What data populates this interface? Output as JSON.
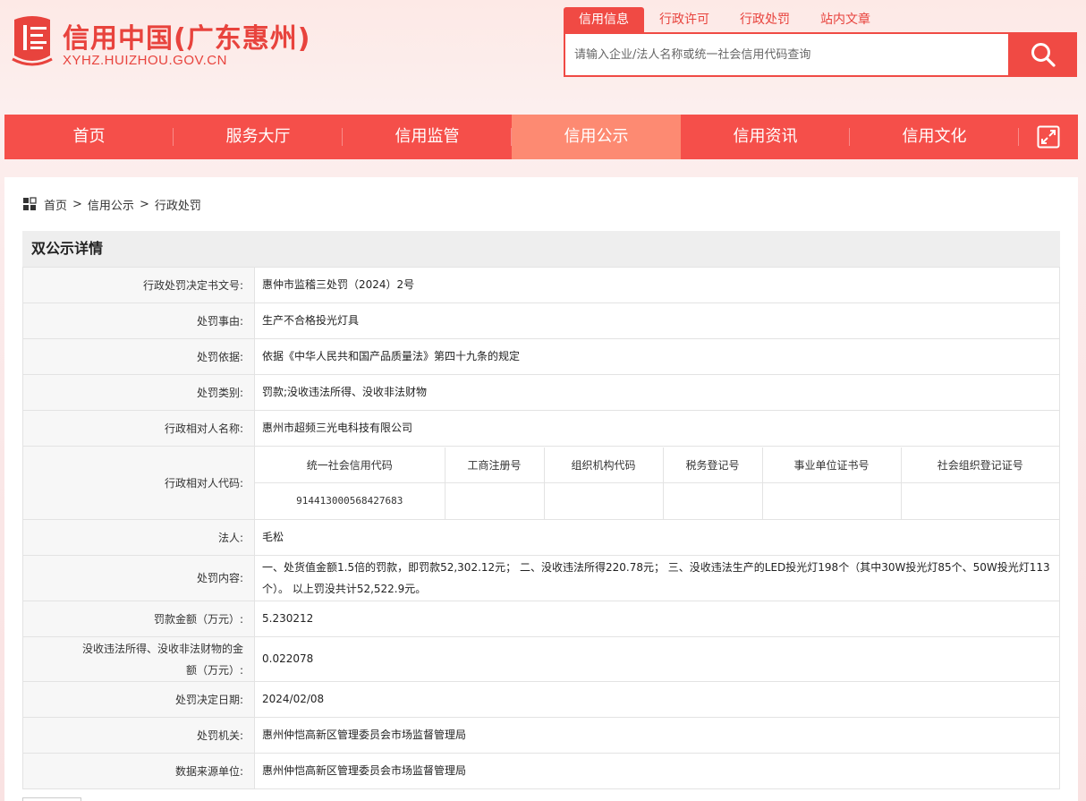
{
  "site": {
    "title": "信用中国(广东惠州)",
    "domain": "XYHZ.HUIZHOU.GOV.CN"
  },
  "colors": {
    "brand": "#f04a44",
    "nav_bg": "#f54f4a",
    "nav_active": "#fd8a72"
  },
  "search": {
    "tabs": [
      "信用信息",
      "行政许可",
      "行政处罚",
      "站内文章"
    ],
    "active_tab": "信用信息",
    "placeholder": "请输入企业/法人名称或统一社会信用代码查询",
    "button_icon": "search-icon"
  },
  "nav": {
    "items": [
      "首页",
      "服务大厅",
      "信用监管",
      "信用公示",
      "信用资讯",
      "信用文化"
    ],
    "active": "信用公示",
    "expand_icon": "expand-icon"
  },
  "breadcrumb": {
    "items": [
      "首页",
      "信用公示",
      "行政处罚"
    ],
    "separator": ">"
  },
  "detail": {
    "heading": "双公示详情",
    "rows": {
      "doc_no": {
        "label": "行政处罚决定书文号:",
        "value": "惠仲市监稽三处罚（2024）2号"
      },
      "reason": {
        "label": "处罚事由:",
        "value": "生产不合格投光灯具"
      },
      "basis": {
        "label": "处罚依据:",
        "value": "依据《中华人民共和国产品质量法》第四十九条的规定"
      },
      "category": {
        "label": "处罚类别:",
        "value": "罚款;没收违法所得、没收非法财物"
      },
      "party_name": {
        "label": "行政相对人名称:",
        "value": "惠州市超频三光电科技有限公司"
      },
      "party_code": {
        "label": "行政相对人代码:",
        "headers": [
          "统一社会信用代码",
          "工商注册号",
          "组织机构代码",
          "税务登记号",
          "事业单位证书号",
          "社会组织登记证号"
        ],
        "values": [
          "91441300056842​7683",
          "",
          "",
          "",
          "",
          ""
        ]
      },
      "legal_person": {
        "label": "法人:",
        "value": "毛松"
      },
      "content": {
        "label": "处罚内容:",
        "value": "一、处货值金额1.5倍的罚款，即罚款52,302.12元； 二、没收违法所得220.78元； 三、没收违法生产的LED投光灯198个（其中30W投光灯85个、50W投光灯113个）。 以上罚没共计52,522.9元。"
      },
      "fine": {
        "label": "罚款金额（万元）:",
        "value": "5.230212"
      },
      "confiscation": {
        "label": "没收违法所得、没收非法财物的金额（万元）:",
        "value": "0.022078"
      },
      "date": {
        "label": "处罚决定日期:",
        "value": "2024/02/08"
      },
      "authority": {
        "label": "处罚机关:",
        "value": "惠州仲恺高新区管理委员会市场监督管理局"
      },
      "source": {
        "label": "数据来源单位:",
        "value": "惠州仲恺高新区管理委员会市场监督管理局"
      }
    }
  }
}
